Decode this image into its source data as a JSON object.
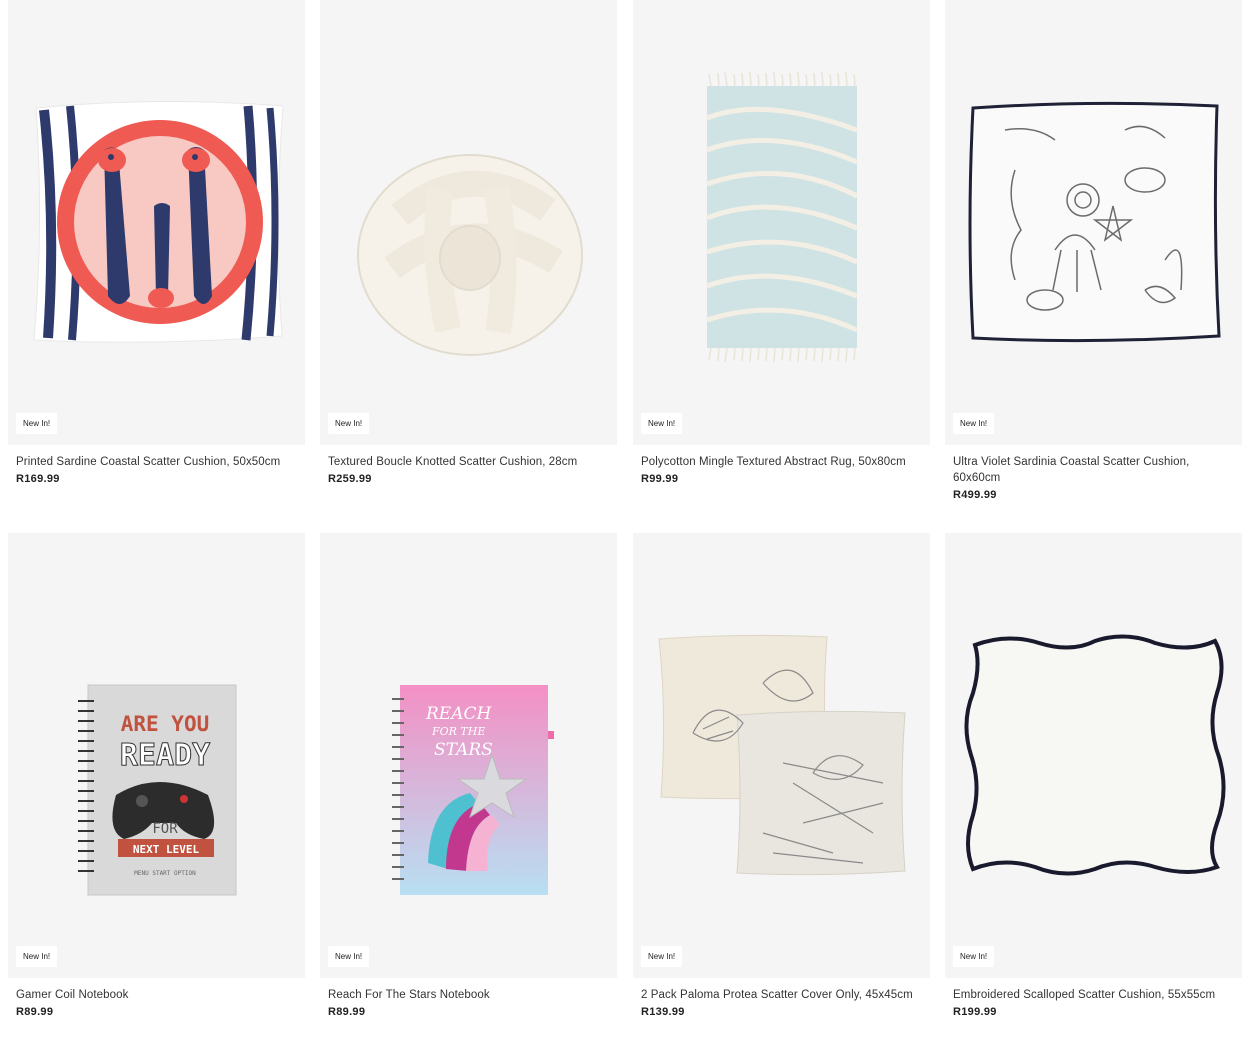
{
  "products": [
    {
      "badge": "New In!",
      "title": "Printed Sardine Coastal Scatter Cushion, 50x50cm",
      "price": "R169.99"
    },
    {
      "badge": "New In!",
      "title": "Textured Boucle Knotted Scatter Cushion, 28cm",
      "price": "R259.99"
    },
    {
      "badge": "New In!",
      "title": "Polycotton Mingle Textured Abstract Rug, 50x80cm",
      "price": "R99.99"
    },
    {
      "badge": "New In!",
      "title": "Ultra Violet Sardinia Coastal Scatter Cushion, 60x60cm",
      "price": "R499.99"
    },
    {
      "badge": "New In!",
      "title": "Gamer Coil Notebook",
      "price": "R89.99"
    },
    {
      "badge": "New In!",
      "title": "Reach For The Stars Notebook",
      "price": "R89.99"
    },
    {
      "badge": "New In!",
      "title": "2 Pack Paloma Protea Scatter Cover Only, 45x45cm",
      "price": "R139.99"
    },
    {
      "badge": "New In!",
      "title": "Embroidered Scalloped Scatter Cushion, 55x55cm",
      "price": "R199.99"
    }
  ],
  "artwork": {
    "notebook1": {
      "line1": "ARE YOU",
      "line2": "READY",
      "line3": "FOR",
      "line4": "NEXT LEVEL",
      "line5": "MENU START OPTION"
    },
    "notebook2": {
      "line1": "REACH",
      "line2": "FOR THE",
      "line3": "STARS"
    }
  }
}
